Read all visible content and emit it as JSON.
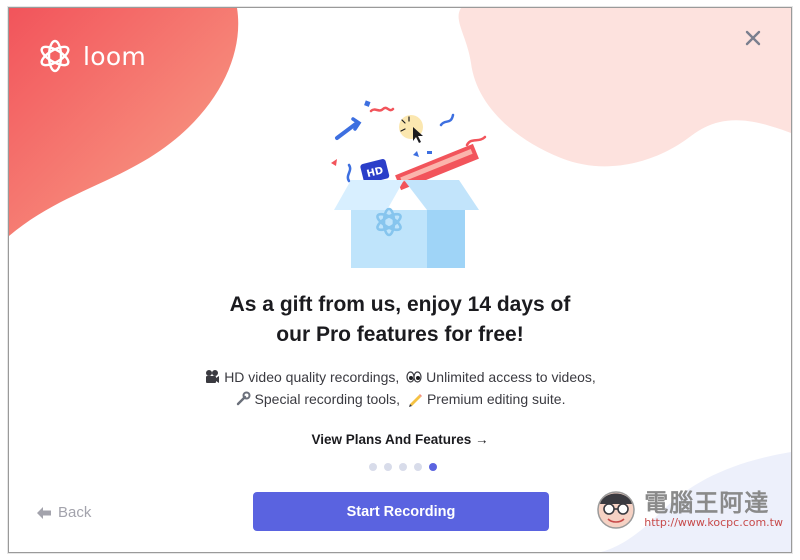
{
  "app": {
    "name": "loom"
  },
  "window": {
    "close_icon": "close-icon"
  },
  "headline": {
    "line1": "As a gift from us, enjoy 14 days of",
    "line2": "our Pro features for free!"
  },
  "features": {
    "line1": [
      {
        "icon": "film-camera-emoji",
        "text": "HD video quality recordings,"
      },
      {
        "icon": "eyes-emoji",
        "text": "Unlimited access to videos,"
      }
    ],
    "line2": [
      {
        "icon": "wrench-emoji",
        "text": "Special recording tools,"
      },
      {
        "icon": "pencil-emoji",
        "text": "Premium editing suite."
      }
    ]
  },
  "links": {
    "view_plans": "View Plans And Features →"
  },
  "carousel": {
    "total": 5,
    "active_index": 4
  },
  "footer": {
    "back_label": "Back",
    "start_label": "Start Recording"
  },
  "illustration": {
    "badge_text": "HD"
  },
  "watermark": {
    "title": "電腦王阿達",
    "url": "http://www.kocpc.com.tw"
  },
  "colors": {
    "accent": "#5a63e0",
    "blob_left": "#f2545b",
    "blob_right": "#fde2de",
    "box": "#bfe4fb"
  }
}
